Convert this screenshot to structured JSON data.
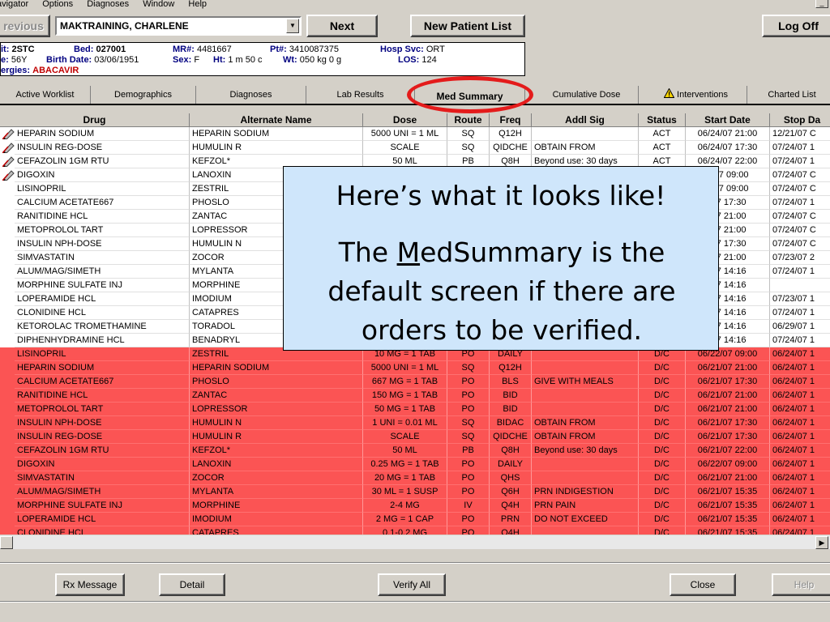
{
  "menu": [
    "avigator",
    "Options",
    "Diagnoses",
    "Window",
    "Help"
  ],
  "toolbar": {
    "previous": "revious",
    "patient_name": "MAKTRAINING, CHARLENE",
    "next": "Next",
    "new_patient_list": "New Patient List",
    "log_off": "Log Off"
  },
  "patient": {
    "unit_label": "it:",
    "unit": "2STC",
    "bed_label": "Bed:",
    "bed": "027001",
    "mr_label": "MR#:",
    "mr": "4481667",
    "pt_label": "Pt#:",
    "pt": "3410087375",
    "hosp_label": "Hosp Svc:",
    "hosp": "ORT",
    "age_label": "e:",
    "age": "56Y",
    "birth_label": "Birth Date:",
    "birth": "03/06/1951",
    "sex_label": "Sex:",
    "sex": "F",
    "ht_label": "Ht:",
    "ht": "1 m 50 c",
    "wt_label": "Wt:",
    "wt": "050 kg 0 g",
    "los_label": "LOS:",
    "los": "124",
    "allergies_label": "ergies:",
    "allergies": "ABACAVIR"
  },
  "tabs": [
    {
      "label": "Active Worklist"
    },
    {
      "label": "Demographics"
    },
    {
      "label": "Diagnoses"
    },
    {
      "label": "Lab Results"
    },
    {
      "label": "Med Summary"
    },
    {
      "label": "Cumulative Dose"
    },
    {
      "label": "Interventions"
    },
    {
      "label": "Charted List"
    }
  ],
  "table": {
    "columns": [
      "Drug",
      "Alternate Name",
      "Dose",
      "Route",
      "Freq",
      "Addl Sig",
      "Status",
      "Start Date",
      "Stop Da"
    ],
    "rows": [
      {
        "flag": true,
        "dc": false,
        "cells": [
          "HEPARIN SODIUM",
          "HEPARIN SODIUM",
          "5000 UNI = 1 ML",
          "SQ",
          "Q12H",
          "",
          "ACT",
          "06/24/07 21:00",
          "12/21/07 C"
        ]
      },
      {
        "flag": true,
        "dc": false,
        "cells": [
          "INSULIN REG-DOSE",
          "HUMULIN R",
          "SCALE",
          "SQ",
          "QIDCHE",
          "OBTAIN FROM",
          "ACT",
          "06/24/07 17:30",
          "07/24/07 1"
        ]
      },
      {
        "flag": true,
        "dc": false,
        "cells": [
          "CEFAZOLIN 1GM RTU",
          "KEFZOL*",
          "50 ML",
          "PB",
          "Q8H",
          "Beyond use: 30 days",
          "ACT",
          "06/24/07 22:00",
          "07/24/07 1"
        ]
      },
      {
        "flag": true,
        "dc": false,
        "cells": [
          "DIGOXIN",
          "LANOXIN",
          "",
          "",
          "",
          "",
          "",
          "5/07 09:00",
          "07/24/07 C"
        ]
      },
      {
        "flag": false,
        "dc": false,
        "cells": [
          "LISINOPRIL",
          "ZESTRIL",
          "",
          "",
          "",
          "",
          "",
          "5/07 09:00",
          "07/24/07 C"
        ]
      },
      {
        "flag": false,
        "dc": false,
        "cells": [
          "CALCIUM ACETATE667",
          "PHOSLO",
          "",
          "",
          "",
          "",
          "",
          "/07 17:30",
          "07/24/07 1"
        ]
      },
      {
        "flag": false,
        "dc": false,
        "cells": [
          "RANITIDINE HCL",
          "ZANTAC",
          "",
          "",
          "",
          "",
          "",
          "/07 21:00",
          "07/24/07 C"
        ]
      },
      {
        "flag": false,
        "dc": false,
        "cells": [
          "METOPROLOL TART",
          "LOPRESSOR",
          "",
          "",
          "",
          "",
          "",
          "/07 21:00",
          "07/24/07 C"
        ]
      },
      {
        "flag": false,
        "dc": false,
        "cells": [
          "INSULIN NPH-DOSE",
          "HUMULIN N",
          "",
          "",
          "",
          "",
          "",
          "/07 17:30",
          "07/24/07 C"
        ]
      },
      {
        "flag": false,
        "dc": false,
        "cells": [
          "SIMVASTATIN",
          "ZOCOR",
          "",
          "",
          "",
          "",
          "",
          "/07 21:00",
          "07/23/07 2"
        ]
      },
      {
        "flag": false,
        "dc": false,
        "cells": [
          "ALUM/MAG/SIMETH",
          "MYLANTA",
          "",
          "",
          "",
          "",
          "",
          "/07 14:16",
          "07/24/07 1"
        ]
      },
      {
        "flag": false,
        "dc": false,
        "cells": [
          "MORPHINE SULFATE INJ",
          "MORPHINE",
          "",
          "",
          "",
          "",
          "",
          "/07 14:16",
          ""
        ]
      },
      {
        "flag": false,
        "dc": false,
        "cells": [
          "LOPERAMIDE HCL",
          "IMODIUM",
          "",
          "",
          "",
          "",
          "",
          "/07 14:16",
          "07/23/07 1"
        ]
      },
      {
        "flag": false,
        "dc": false,
        "cells": [
          "CLONIDINE HCL",
          "CATAPRES",
          "",
          "",
          "",
          "",
          "",
          "/07 14:16",
          "07/24/07 1"
        ]
      },
      {
        "flag": false,
        "dc": false,
        "cells": [
          "KETOROLAC TROMETHAMINE",
          "TORADOL",
          "",
          "",
          "",
          "",
          "",
          "/07 14:16",
          "06/29/07 1"
        ]
      },
      {
        "flag": false,
        "dc": false,
        "cells": [
          "DIPHENHYDRAMINE HCL",
          "BENADRYL",
          "",
          "",
          "",
          "",
          "",
          "/07 14:16",
          "07/24/07 1"
        ]
      },
      {
        "flag": false,
        "dc": true,
        "cells": [
          "LISINOPRIL",
          "ZESTRIL",
          "10 MG = 1 TAB",
          "PO",
          "DAILY",
          "",
          "D/C",
          "06/22/07 09:00",
          "06/24/07 1"
        ]
      },
      {
        "flag": false,
        "dc": true,
        "cells": [
          "HEPARIN SODIUM",
          "HEPARIN SODIUM",
          "5000 UNI = 1 ML",
          "SQ",
          "Q12H",
          "",
          "D/C",
          "06/21/07 21:00",
          "06/24/07 1"
        ]
      },
      {
        "flag": false,
        "dc": true,
        "cells": [
          "CALCIUM ACETATE667",
          "PHOSLO",
          "667 MG = 1 TAB",
          "PO",
          "BLS",
          "GIVE WITH MEALS",
          "D/C",
          "06/21/07 17:30",
          "06/24/07 1"
        ]
      },
      {
        "flag": false,
        "dc": true,
        "cells": [
          "RANITIDINE HCL",
          "ZANTAC",
          "150 MG = 1 TAB",
          "PO",
          "BID",
          "",
          "D/C",
          "06/21/07 21:00",
          "06/24/07 1"
        ]
      },
      {
        "flag": false,
        "dc": true,
        "cells": [
          "METOPROLOL TART",
          "LOPRESSOR",
          "50 MG = 1 TAB",
          "PO",
          "BID",
          "",
          "D/C",
          "06/21/07 21:00",
          "06/24/07 1"
        ]
      },
      {
        "flag": false,
        "dc": true,
        "cells": [
          "INSULIN NPH-DOSE",
          "HUMULIN N",
          "1 UNI = 0.01 ML",
          "SQ",
          "BIDAC",
          "OBTAIN FROM",
          "D/C",
          "06/21/07 17:30",
          "06/24/07 1"
        ]
      },
      {
        "flag": false,
        "dc": true,
        "cells": [
          "INSULIN REG-DOSE",
          "HUMULIN R",
          "SCALE",
          "SQ",
          "QIDCHE",
          "OBTAIN FROM",
          "D/C",
          "06/21/07 17:30",
          "06/24/07 1"
        ]
      },
      {
        "flag": false,
        "dc": true,
        "cells": [
          "CEFAZOLIN 1GM RTU",
          "KEFZOL*",
          "50 ML",
          "PB",
          "Q8H",
          "Beyond use: 30 days",
          "D/C",
          "06/21/07 22:00",
          "06/24/07 1"
        ]
      },
      {
        "flag": false,
        "dc": true,
        "cells": [
          "DIGOXIN",
          "LANOXIN",
          "0.25 MG = 1 TAB",
          "PO",
          "DAILY",
          "",
          "D/C",
          "06/22/07 09:00",
          "06/24/07 1"
        ]
      },
      {
        "flag": false,
        "dc": true,
        "cells": [
          "SIMVASTATIN",
          "ZOCOR",
          "20 MG = 1 TAB",
          "PO",
          "QHS",
          "",
          "D/C",
          "06/21/07 21:00",
          "06/24/07 1"
        ]
      },
      {
        "flag": false,
        "dc": true,
        "cells": [
          "ALUM/MAG/SIMETH",
          "MYLANTA",
          "30 ML = 1 SUSP",
          "PO",
          "Q6H",
          "PRN INDIGESTION",
          "D/C",
          "06/21/07 15:35",
          "06/24/07 1"
        ]
      },
      {
        "flag": false,
        "dc": true,
        "cells": [
          "MORPHINE SULFATE INJ",
          "MORPHINE",
          "2-4 MG",
          "IV",
          "Q4H",
          "PRN PAIN",
          "D/C",
          "06/21/07 15:35",
          "06/24/07 1"
        ]
      },
      {
        "flag": false,
        "dc": true,
        "cells": [
          "LOPERAMIDE HCL",
          "IMODIUM",
          "2 MG = 1 CAP",
          "PO",
          "PRN",
          "DO NOT EXCEED",
          "D/C",
          "06/21/07 15:35",
          "06/24/07 1"
        ]
      },
      {
        "flag": false,
        "dc": true,
        "cells": [
          "CLONIDINE HCL",
          "CATAPRES",
          "0.1-0.2 MG",
          "PO",
          "Q4H",
          "",
          "D/C",
          "06/21/07 15:35",
          "06/24/07 1"
        ]
      }
    ]
  },
  "callout": {
    "line1": "Here’s what it looks like!",
    "line2_pre": "The ",
    "line2_u": "M",
    "line2_post": "edSummary is the default screen if there are orders to be verified."
  },
  "bottom": {
    "rx_message": "Rx Message",
    "detail": "Detail",
    "verify_all": "Verify All",
    "close": "Close",
    "help": "Help"
  },
  "colors": {
    "dc_row": "#fb5454",
    "callout_bg": "#cfe6fb",
    "highlight_circle": "#e41b1b",
    "window_bg": "#d4d0c8"
  }
}
